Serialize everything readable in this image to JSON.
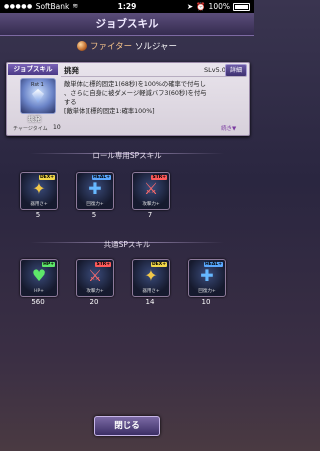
{
  "status": {
    "carrier": "SoftBank",
    "time": "1:29",
    "battery": "100%"
  },
  "header": {
    "title": "ジョブスキル"
  },
  "crumb": {
    "job": "ファイター",
    "skill": "ソルジャー"
  },
  "panel": {
    "tag": "ジョブスキル",
    "name": "挑発",
    "level": "SLv5.0",
    "detail_label": "詳細",
    "icon_level": "Rst 1",
    "icon_name": "挑発",
    "charge_label": "チャージタイム",
    "charge_value": "10",
    "desc_lines": [
      "敵単体に標的固定1(68秒)を100%の確率で付与し",
      "、さらに自身に被ダメージ軽減バフ3(60秒)を付与",
      "する",
      "[敵単体][標的固定1:確率100%]"
    ],
    "more_label": "続き▼"
  },
  "role_section": {
    "title": "ロール専用SPスキル",
    "cards": [
      {
        "tag": "DEX+",
        "tag_color": "#f2d84a",
        "symbol": "✦",
        "sym_color": "#f2c84a",
        "caption": "器用さ+",
        "value": "5"
      },
      {
        "tag": "HEAL+",
        "tag_color": "#5aa8ff",
        "symbol": "✚",
        "sym_color": "#66b8ff",
        "caption": "回復力+",
        "value": "5"
      },
      {
        "tag": "STR+",
        "tag_color": "#ff5a5a",
        "symbol": "⚔",
        "sym_color": "#ff6a6a",
        "caption": "攻撃力+",
        "value": "7"
      }
    ]
  },
  "common_section": {
    "title": "共通SPスキル",
    "cards": [
      {
        "tag": "HP+",
        "tag_color": "#5ee86a",
        "symbol": "♥",
        "sym_color": "#5ee86a",
        "caption": "HP+",
        "value": "560"
      },
      {
        "tag": "STR+",
        "tag_color": "#ff5a5a",
        "symbol": "⚔",
        "sym_color": "#ff6a6a",
        "caption": "攻撃力+",
        "value": "20"
      },
      {
        "tag": "DEX+",
        "tag_color": "#f2d84a",
        "symbol": "✦",
        "sym_color": "#f2c84a",
        "caption": "器用さ+",
        "value": "14"
      },
      {
        "tag": "HEAL+",
        "tag_color": "#5aa8ff",
        "symbol": "✚",
        "sym_color": "#66b8ff",
        "caption": "回復力+",
        "value": "10"
      }
    ]
  },
  "footer": {
    "close_label": "閉じる"
  }
}
